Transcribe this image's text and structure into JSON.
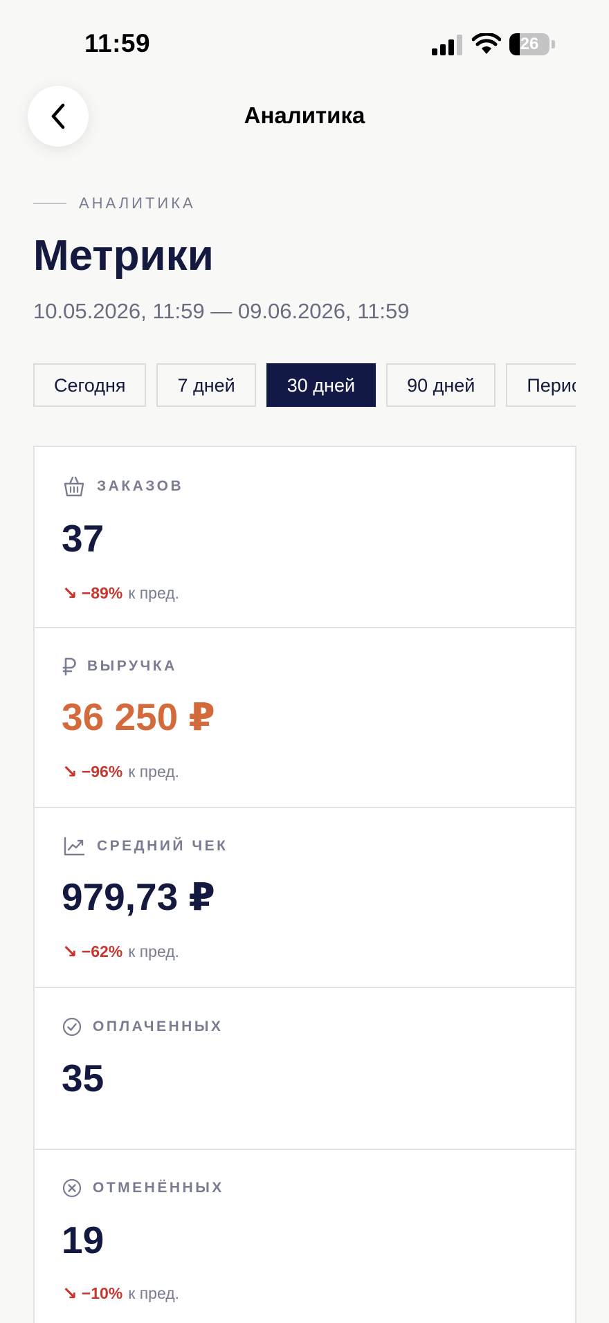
{
  "status_bar": {
    "time": "11:59",
    "battery_level": "26",
    "battery_fraction": 0.26
  },
  "nav": {
    "back_icon": "chevron-left-icon",
    "title": "Аналитика"
  },
  "header": {
    "eyebrow": "АНАЛИТИКА",
    "title": "Метрики",
    "date_range": "10.05.2026, 11:59 — 09.06.2026, 11:59"
  },
  "periods": {
    "items": [
      "Сегодня",
      "7 дней",
      "30 дней",
      "90 дней",
      "Период"
    ],
    "selected": "30 дней"
  },
  "colors": {
    "primary": "#121947",
    "accent": "#d46a3c",
    "negative": "#c6372f",
    "muted": "#7a7d92"
  },
  "metrics": [
    {
      "icon": "basket-icon",
      "label": "ЗАКАЗОВ",
      "value": "37",
      "change_arrow": "↘",
      "change": "−89%",
      "change_suffix": "к пред."
    },
    {
      "icon": "ruble-icon",
      "label": "ВЫРУЧКА",
      "value": "36 250 ₽",
      "change_arrow": "↘",
      "change": "−96%",
      "change_suffix": "к пред."
    },
    {
      "icon": "trend-chart-icon",
      "label": "СРЕДНИЙ ЧЕК",
      "value": "979,73 ₽",
      "change_arrow": "↘",
      "change": "−62%",
      "change_suffix": "к пред."
    },
    {
      "icon": "check-circle-icon",
      "label": "ОПЛАЧЕННЫХ",
      "value": "35"
    },
    {
      "icon": "x-circle-icon",
      "label": "ОТМЕНЁННЫХ",
      "value": "19",
      "change_arrow": "↘",
      "change": "−10%",
      "change_suffix": "к пред."
    }
  ]
}
